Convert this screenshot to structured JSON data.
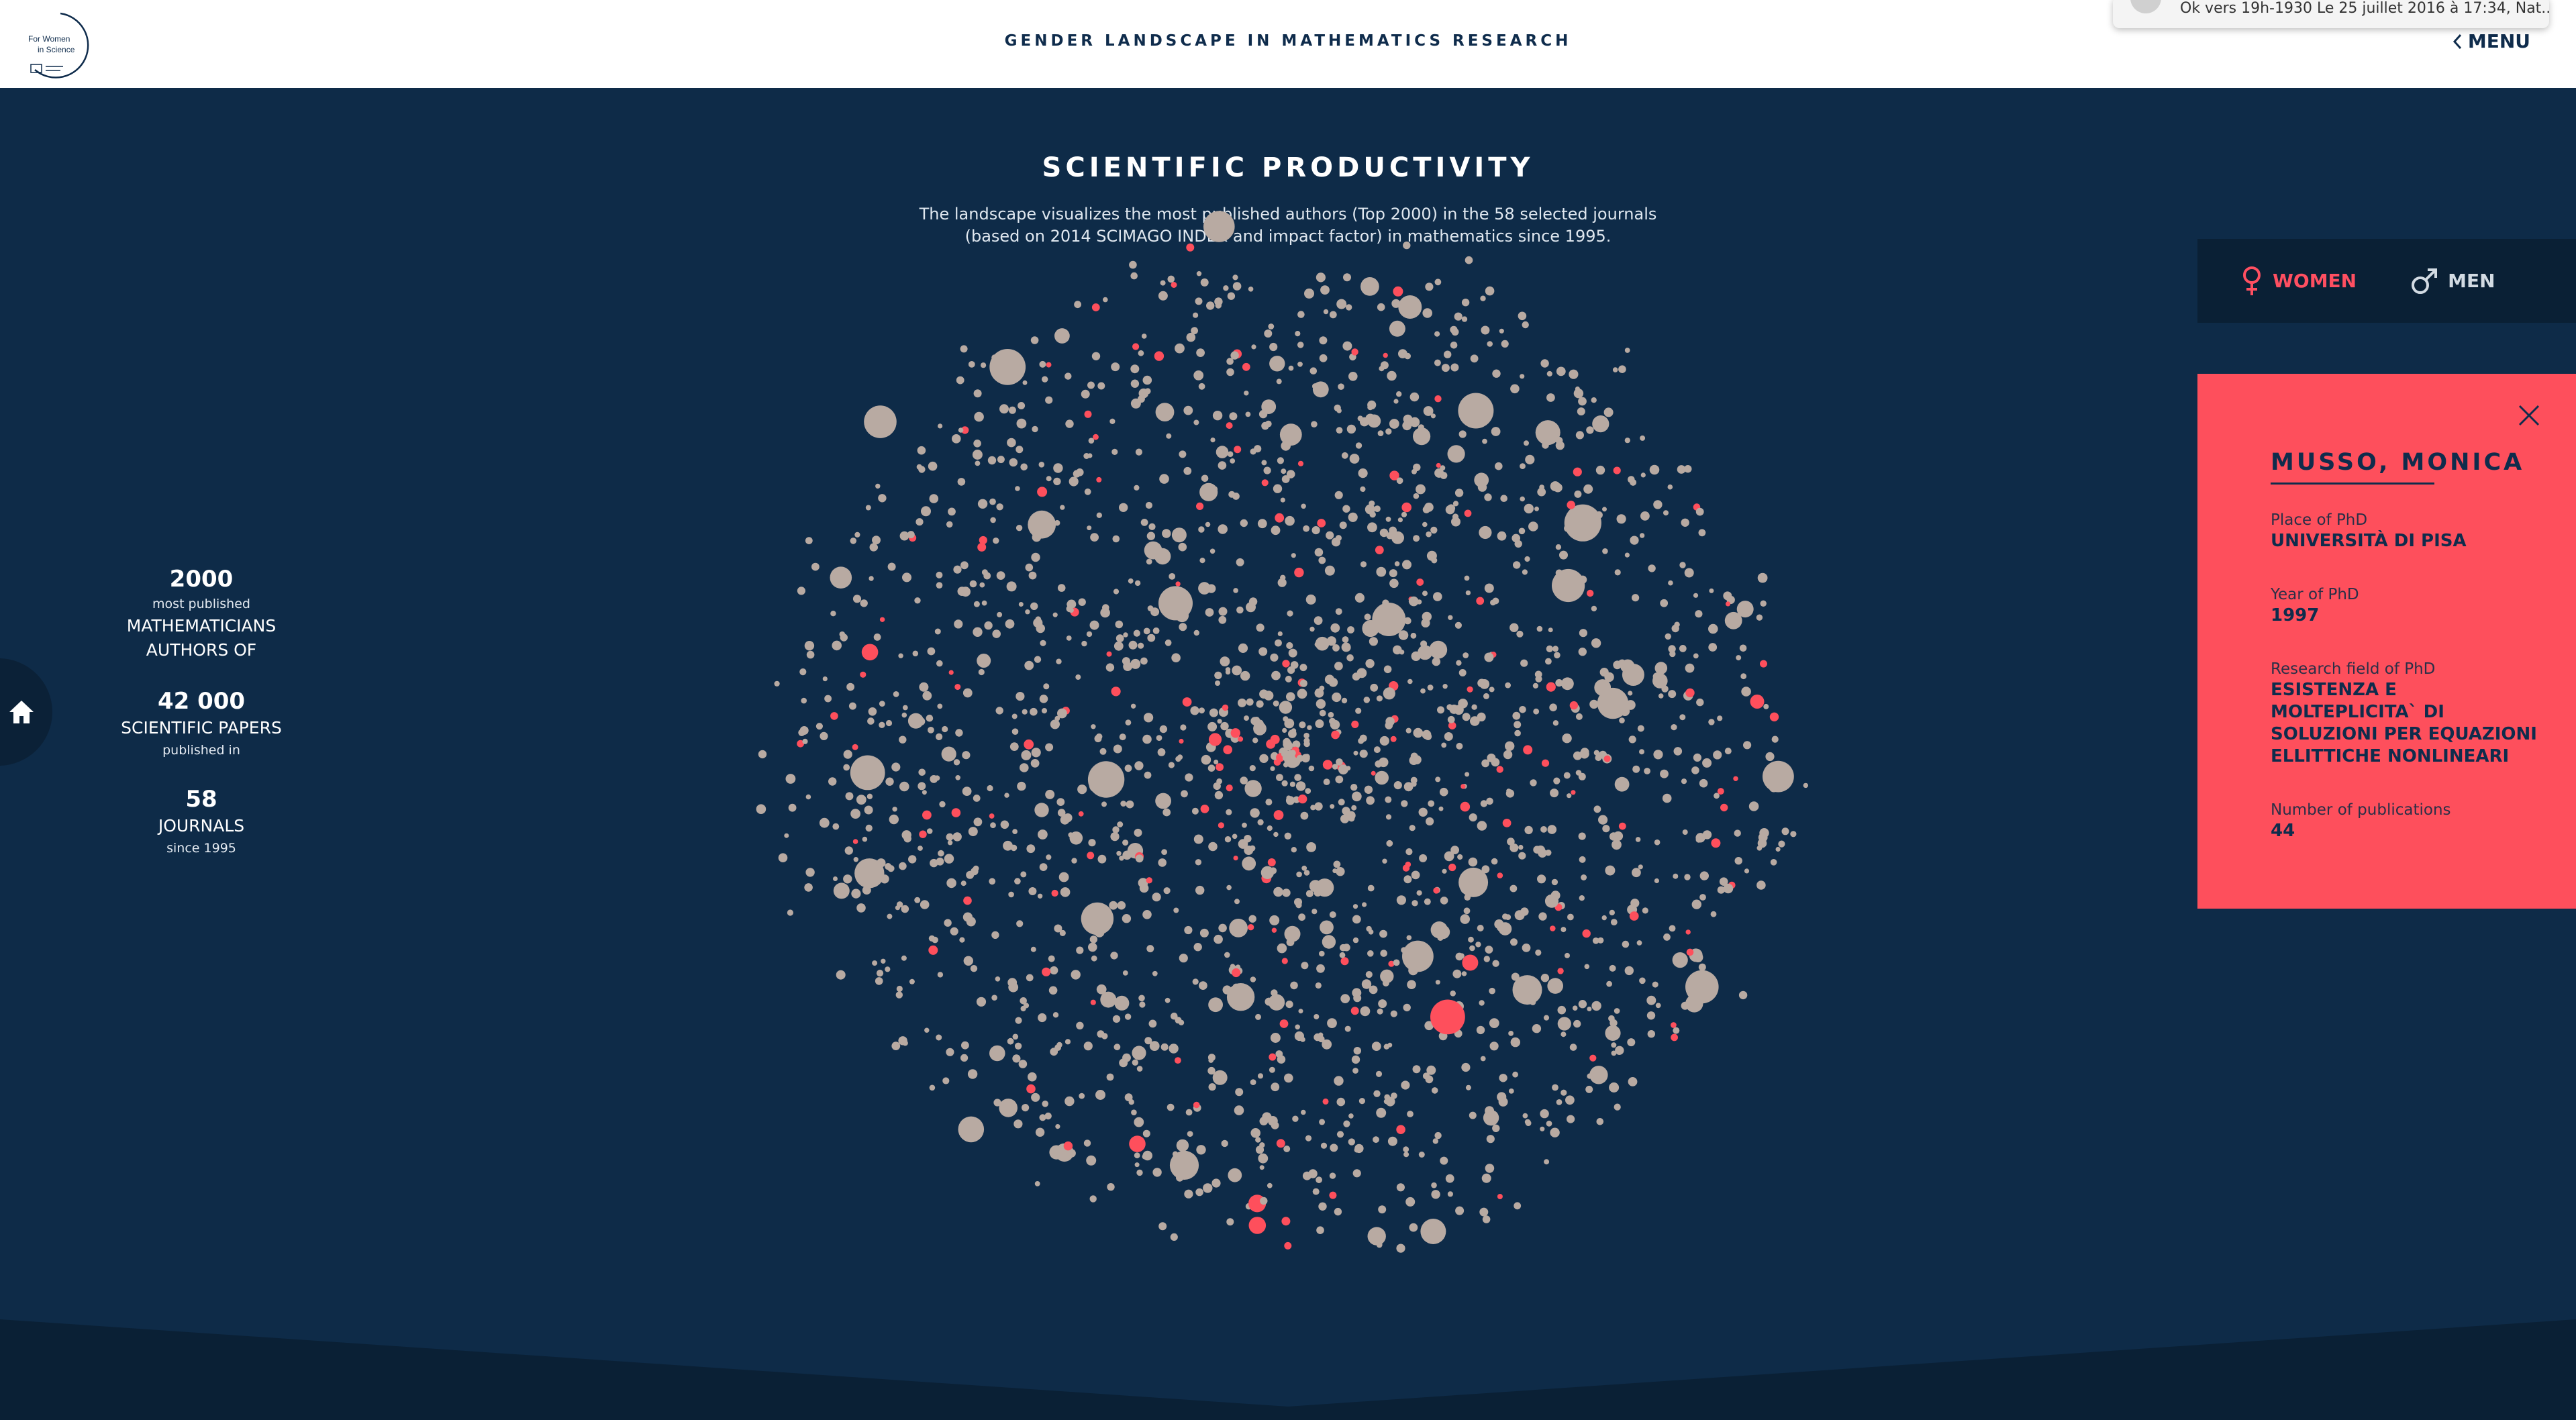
{
  "header": {
    "logo_text_line1": "For Women",
    "logo_text_line2": "in Science",
    "site_title": "GENDER LANDSCAPE IN MATHEMATICS RESEARCH",
    "menu_label": "MENU"
  },
  "notification": {
    "text": "Ok vers 19h-1930 Le 25 juillet 2016 à 17:34, Nat..."
  },
  "section": {
    "title": "SCIENTIFIC PRODUCTIVITY",
    "description_line1": "The landscape visualizes the most published authors (Top 2000) in the 58 selected journals",
    "description_line2": "(based on 2014 SCIMAGO INDEX and impact factor) in mathematics since 1995."
  },
  "stats": {
    "authors_count": "2000",
    "authors_small": "most published",
    "authors_label_1": "MATHEMATICIANS",
    "authors_label_2": "AUTHORS OF",
    "papers_count": "42 000",
    "papers_label": "SCIENTIFIC PAPERS",
    "papers_small": "published in",
    "journals_count": "58",
    "journals_label": "JOURNALS",
    "journals_small": "since 1995"
  },
  "gender_toggle": {
    "women_label": "WOMEN",
    "men_label": "MEN",
    "selected": "WOMEN"
  },
  "author_card": {
    "name": "MUSSO, MONICA",
    "place_label": "Place of PhD",
    "place_value": "UNIVERSITÀ DI PISA",
    "year_label": "Year of PhD",
    "year_value": "1997",
    "field_label": "Research field of PhD",
    "field_value": "ESISTENZA E MOLTEPLICITA` DI SOLUZIONI PER EQUAZIONI ELLITTICHE NONLINEARI",
    "publications_label": "Number of publications",
    "publications_value": "44"
  },
  "colors": {
    "background": "#0e2b48",
    "women": "#fe4f5c",
    "men": "#b8aaa2",
    "header": "#ffffff",
    "text_dark": "#0f2c4c"
  },
  "visualization": {
    "total_authors": 2000,
    "women_share": 0.1
  }
}
